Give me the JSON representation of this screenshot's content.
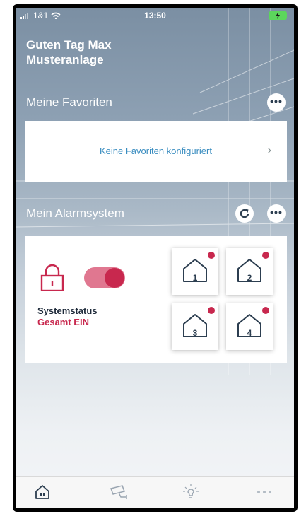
{
  "status_bar": {
    "carrier": "1&1",
    "time": "13:50"
  },
  "greeting": {
    "line1": "Guten Tag Max",
    "line2": "Musteranlage"
  },
  "favorites": {
    "title": "Meine Favoriten",
    "empty_text": "Keine Favoriten konfiguriert"
  },
  "alarm": {
    "title": "Mein Alarmsystem",
    "status_label": "Systemstatus",
    "status_value": "Gesamt EIN",
    "armed": true,
    "zones": [
      {
        "label": "1"
      },
      {
        "label": "2"
      },
      {
        "label": "3"
      },
      {
        "label": "4"
      }
    ]
  },
  "colors": {
    "accent": "#c8284e",
    "link": "#3a8dc0",
    "text_dark": "#1e2a3a"
  },
  "tab_bar": {
    "items": [
      "home-icon",
      "camera-icon",
      "light-bulb-icon",
      "more-icon"
    ],
    "active": "home-icon"
  }
}
